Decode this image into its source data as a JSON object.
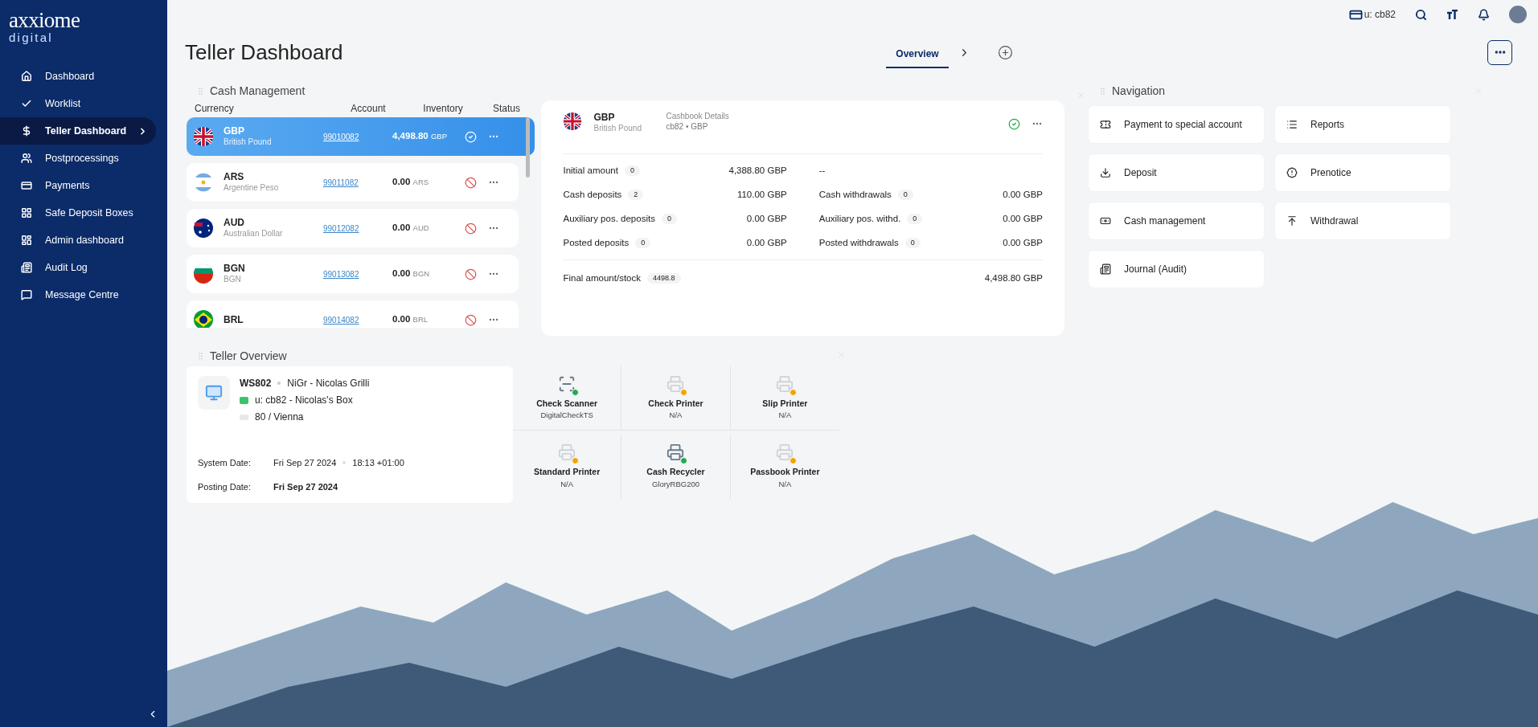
{
  "logo": {
    "brand": "axxiome",
    "sub": "digital"
  },
  "sidebar": {
    "items": [
      {
        "label": "Dashboard",
        "selected": false
      },
      {
        "label": "Worklist",
        "selected": false
      },
      {
        "label": "Teller Dashboard",
        "selected": true
      },
      {
        "label": "Postprocessings",
        "selected": false
      },
      {
        "label": "Payments",
        "selected": false
      },
      {
        "label": "Safe Deposit Boxes",
        "selected": false
      },
      {
        "label": "Admin dashboard",
        "selected": false
      },
      {
        "label": "Audit Log",
        "selected": false
      },
      {
        "label": "Message Centre",
        "selected": false
      }
    ]
  },
  "top_bar": {
    "cashbox": "u: cb82"
  },
  "page": {
    "title": "Teller Dashboard",
    "tabs": [
      {
        "label": "Overview",
        "selected": true
      }
    ]
  },
  "cash_management": {
    "title": "Cash Management",
    "columns": [
      "Currency",
      "Account",
      "Inventory",
      "Status"
    ],
    "rows": [
      {
        "code": "GBP",
        "name": "British Pound",
        "account": "99010082",
        "amount": "4,498.80",
        "unit": "GBP",
        "active": true,
        "selected": true
      },
      {
        "code": "ARS",
        "name": "Argentine Peso",
        "account": "99011082",
        "amount": "0.00",
        "unit": "ARS",
        "active": false,
        "selected": false
      },
      {
        "code": "AUD",
        "name": "Australian Dollar",
        "account": "99012082",
        "amount": "0.00",
        "unit": "AUD",
        "active": false,
        "selected": false
      },
      {
        "code": "BGN",
        "name": "BGN",
        "account": "99013082",
        "amount": "0.00",
        "unit": "BGN",
        "active": false,
        "selected": false
      },
      {
        "code": "BRL",
        "account": "99014082",
        "amount": "0.00",
        "unit": "BRL",
        "active": false,
        "selected": false
      }
    ]
  },
  "cashbook": {
    "code": "GBP",
    "name": "British Pound",
    "title": "Cashbook Details",
    "subtitle": "cb82 • GBP",
    "active": true,
    "left": [
      {
        "label": "Initial amount",
        "count": "0",
        "amount": "4,388.80 GBP"
      },
      {
        "label": "Cash deposits",
        "count": "2",
        "amount": "110.00 GBP"
      },
      {
        "label": "Auxiliary pos. deposits",
        "count": "0",
        "amount": "0.00 GBP"
      },
      {
        "label": "Posted deposits",
        "count": "0",
        "amount": "0.00 GBP"
      }
    ],
    "right": [
      {
        "kind": "empty",
        "text": "--"
      },
      {
        "kind": "entry",
        "label": "Cash withdrawals",
        "count": "0",
        "amount": "0.00 GBP"
      },
      {
        "kind": "entry",
        "label": "Auxiliary pos. withd.",
        "count": "0",
        "amount": "0.00 GBP"
      },
      {
        "kind": "entry",
        "label": "Posted withdrawals",
        "count": "0",
        "amount": "0.00 GBP"
      }
    ],
    "final": {
      "label": "Final amount/stock",
      "count": "4498.8",
      "amount": "4,498.80 GBP"
    }
  },
  "navigation": {
    "title": "Navigation",
    "items": [
      "Payment to special account",
      "Reports",
      "Deposit",
      "Prenotice",
      "Cash management",
      "Withdrawal",
      "Journal (Audit)"
    ]
  },
  "teller_overview": {
    "title": "Teller Overview",
    "workstation": "WS802",
    "user": "NiGr - Nicolas Grilli",
    "cashbox": "u: cb82 - Nicolas's Box",
    "branch": "80 / Vienna",
    "system_date_label": "System Date:",
    "system_date": "Fri Sep 27 2024",
    "system_time": "18:13 +01:00",
    "posting_date_label": "Posting Date:",
    "posting_date": "Fri Sep 27 2024",
    "devices": [
      {
        "name": "Check Scanner",
        "model": "DigitalCheckTS",
        "connected": true
      },
      {
        "name": "Check Printer",
        "model": "N/A",
        "connected": false
      },
      {
        "name": "Slip Printer",
        "model": "N/A",
        "connected": false
      },
      {
        "name": "Standard Printer",
        "model": "N/A",
        "connected": false
      },
      {
        "name": "Cash Recycler",
        "model": "GloryRBG200",
        "connected": true
      },
      {
        "name": "Passbook Printer",
        "model": "N/A",
        "connected": false
      }
    ]
  }
}
